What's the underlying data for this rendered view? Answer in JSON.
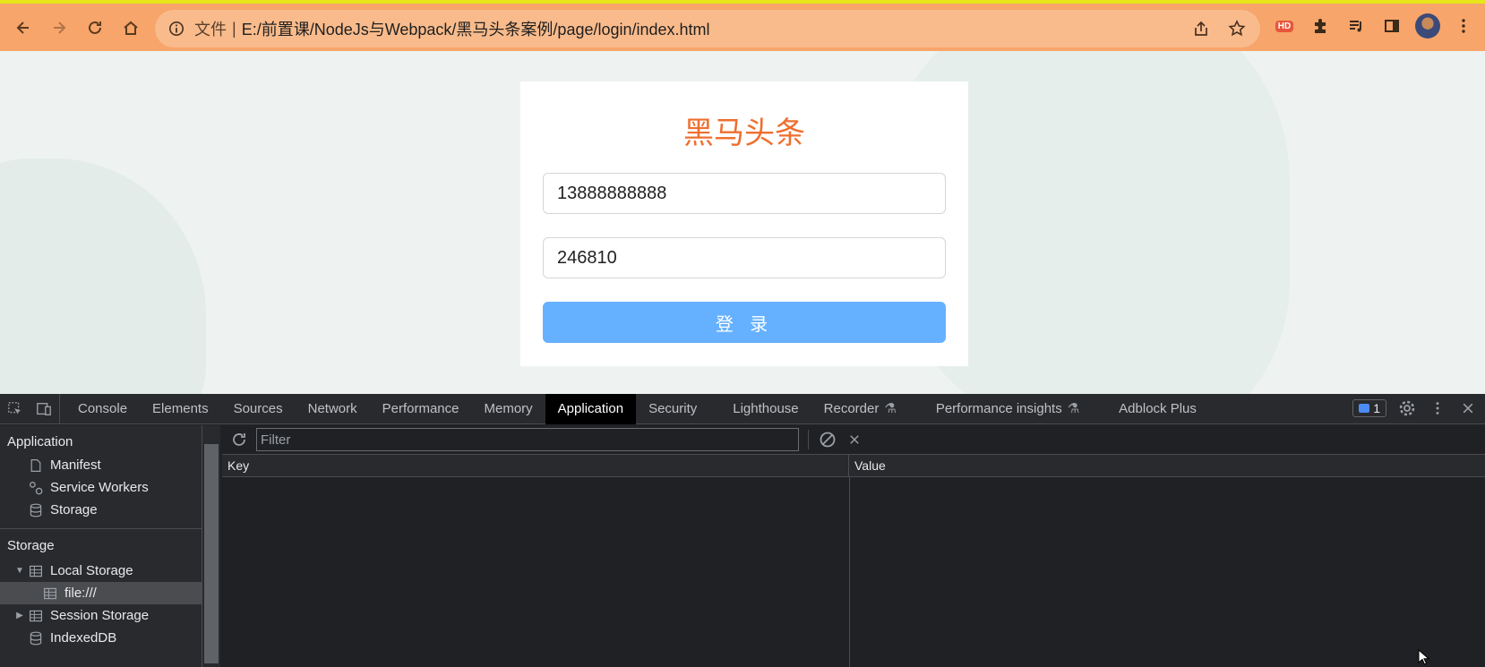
{
  "browser": {
    "omnibox_label": "文件",
    "separator": "|",
    "url": "E:/前置课/NodeJs与Webpack/黑马头条案例/page/login/index.html",
    "hd_badge": "HD",
    "accent_color": "#f7a56a"
  },
  "page": {
    "title": "黑马头条",
    "phone_value": "13888888888",
    "code_value": "246810",
    "login_label": "登 录",
    "title_color": "#ef6f2f",
    "button_color": "#66b1ff"
  },
  "devtools": {
    "tabs": [
      {
        "label": "Console"
      },
      {
        "label": "Elements"
      },
      {
        "label": "Sources"
      },
      {
        "label": "Network"
      },
      {
        "label": "Performance"
      },
      {
        "label": "Memory"
      },
      {
        "label": "Application",
        "active": true
      },
      {
        "label": "Security"
      },
      {
        "label": "Lighthouse"
      },
      {
        "label": "Recorder",
        "experimental": true
      },
      {
        "label": "Performance insights",
        "experimental": true
      },
      {
        "label": "Adblock Plus"
      }
    ],
    "issues_count": "1",
    "sidebar": {
      "application_heading": "Application",
      "application_items": [
        {
          "label": "Manifest",
          "icon": "file-icon"
        },
        {
          "label": "Service Workers",
          "icon": "gears-icon"
        },
        {
          "label": "Storage",
          "icon": "database-icon"
        }
      ],
      "storage_heading": "Storage",
      "storage_items": [
        {
          "label": "Local Storage",
          "icon": "table-icon",
          "expanded": true
        },
        {
          "label": "file:///",
          "icon": "table-icon",
          "selected": true
        },
        {
          "label": "Session Storage",
          "icon": "table-icon",
          "expanded": false
        },
        {
          "label": "IndexedDB",
          "icon": "database-icon"
        }
      ]
    },
    "filter_placeholder": "Filter",
    "columns": {
      "key": "Key",
      "value": "Value"
    }
  }
}
